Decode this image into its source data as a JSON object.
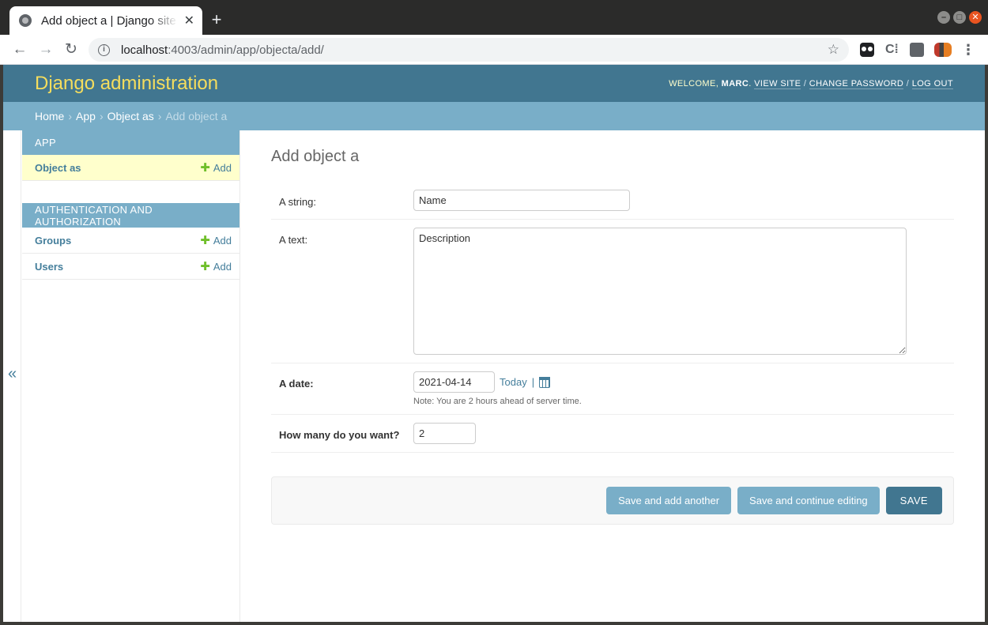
{
  "browser": {
    "tab_title": "Add object a | Django site admin",
    "tab_close": "✕",
    "new_tab": "+",
    "url_host": "localhost",
    "url_rest": ":4003/admin/app/objecta/add/",
    "back": "←",
    "forward": "→",
    "reload": "↻",
    "info": "i",
    "star": "☆",
    "ext2": "C⁞",
    "menu": "⋮",
    "win_min": "–",
    "win_max": "□",
    "win_close": "✕"
  },
  "header": {
    "brand": "Django administration",
    "welcome": "WELCOME,",
    "username": "MARC",
    "view_site": "VIEW SITE",
    "change_password": "CHANGE PASSWORD",
    "log_out": "LOG OUT",
    "sep": "/"
  },
  "breadcrumbs": {
    "home": "Home",
    "app": "App",
    "model": "Object as",
    "current": "Add object a",
    "arrow": "›"
  },
  "sidebar": {
    "collapse": "«",
    "add_label": "Add",
    "plus": "✚",
    "modules": [
      {
        "caption": "APP",
        "models": [
          {
            "name": "Object as"
          }
        ]
      },
      {
        "caption": "AUTHENTICATION AND AUTHORIZATION",
        "models": [
          {
            "name": "Groups"
          },
          {
            "name": "Users"
          }
        ]
      }
    ]
  },
  "content": {
    "title": "Add object a",
    "fields": {
      "a_string": {
        "label": "A string:",
        "value": "Name"
      },
      "a_text": {
        "label": "A text:",
        "value": "Description"
      },
      "a_date": {
        "label": "A date:",
        "value": "2021-04-14",
        "today": "Today",
        "pipe": "|",
        "help": "Note: You are 2 hours ahead of server time."
      },
      "how_many": {
        "label": "How many do you want?",
        "value": "2"
      }
    },
    "buttons": {
      "save_add_another": "Save and add another",
      "save_continue": "Save and continue editing",
      "save": "SAVE"
    }
  }
}
